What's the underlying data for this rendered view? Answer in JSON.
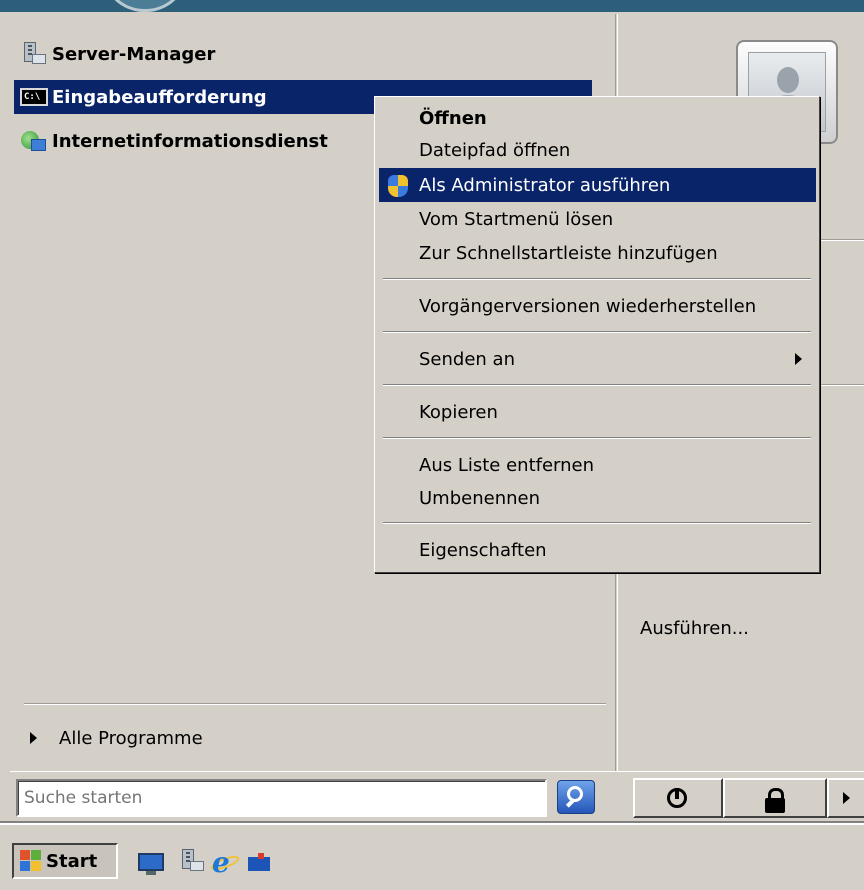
{
  "start_menu": {
    "pinned": [
      {
        "label": "Server-Manager",
        "icon": "server-manager-icon"
      },
      {
        "label": "Eingabeaufforderung",
        "icon": "command-prompt-icon",
        "selected": true
      },
      {
        "label": "Internetinformationsdienst",
        "icon": "iis-icon"
      }
    ],
    "all_programs_label": "Alle Programme",
    "right_panel": {
      "run_label": "Ausführen..."
    },
    "search": {
      "placeholder": "Suche starten"
    }
  },
  "context_menu": {
    "items": [
      {
        "label": "Öffnen",
        "bold": true
      },
      {
        "label": "Dateipfad öffnen"
      },
      {
        "label": "Als Administrator ausführen",
        "highlighted": true,
        "icon": "uac-shield-icon"
      },
      {
        "label": "Vom Startmenü lösen"
      },
      {
        "label": "Zur Schnellstartleiste hinzufügen"
      },
      {
        "label": "Vorgängerversionen wiederherstellen"
      },
      {
        "label": "Senden an",
        "submenu": true
      },
      {
        "label": "Kopieren"
      },
      {
        "label": "Aus Liste entfernen"
      },
      {
        "label": "Umbenennen"
      },
      {
        "label": "Eigenschaften"
      }
    ]
  },
  "taskbar": {
    "start_label": "Start",
    "quick_launch": [
      "show-desktop-icon",
      "server-manager-icon",
      "internet-explorer-icon",
      "network-icon"
    ]
  },
  "colors": {
    "selection": "#0a246a",
    "face": "#d4d0c8",
    "title_strip": "#2d5f7a"
  }
}
